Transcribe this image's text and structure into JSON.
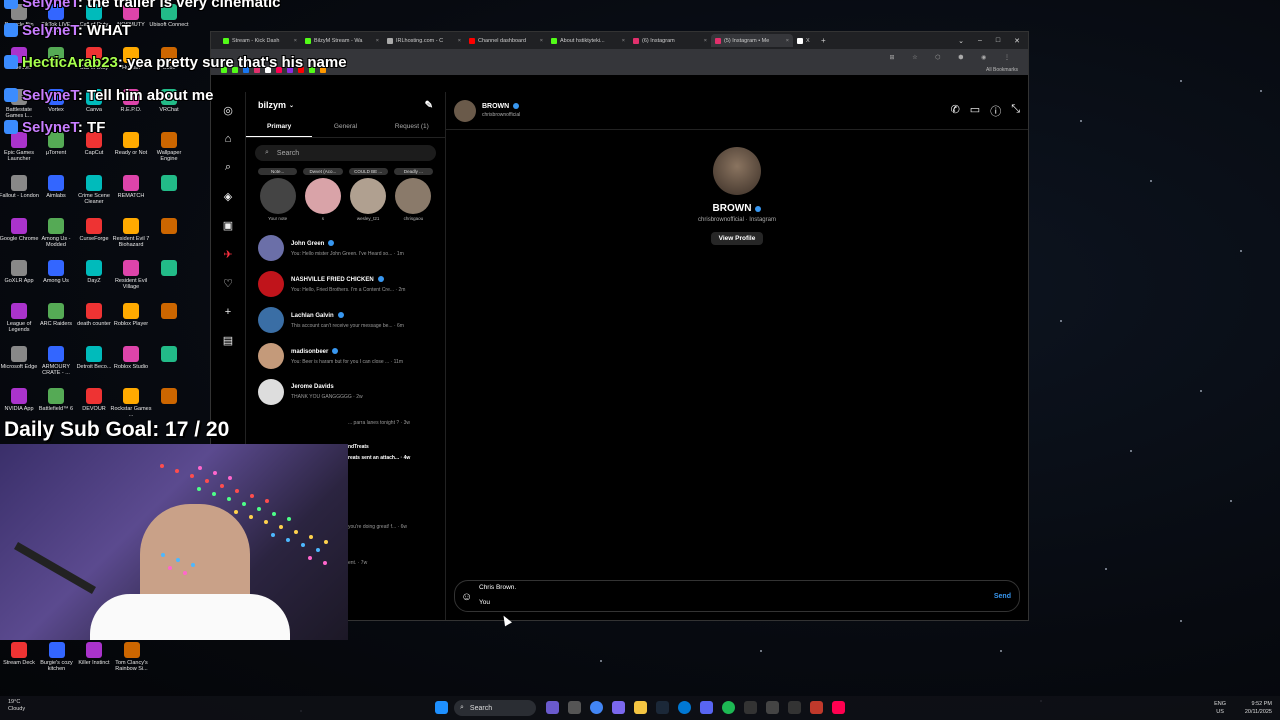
{
  "chat": [
    {
      "user": "SelyneT",
      "msg": ": the trailer is very cinematic"
    },
    {
      "user": "SelyneT",
      "msg": ": WHAT"
    },
    {
      "user": "HecticArab23",
      "msg": ": yea pretty sure that's his name"
    },
    {
      "user": "SelyneT",
      "msg": ": Tell him about me"
    },
    {
      "user": "SelyneT",
      "msg": ": TF"
    }
  ],
  "subgoal": "Daily Sub Goal: 17 / 20",
  "desktop_icons": [
    "Recycle Bin",
    "TikTok LIVE Studio",
    "Call of Duty",
    "NOSMUTY",
    "Ubisoft Connect",
    "Battle.net",
    "",
    "Call of Duty",
    "Human",
    "Code",
    "Battlestate Games L...",
    "Vortex",
    "Canva",
    "R.E.P.O.",
    "VRChat",
    "Epic Games Launcher",
    "µTorrent",
    "CapCut",
    "Ready or Not",
    "Wallpaper Engine",
    "Fallout - London",
    "Aimlabs",
    "Crime Scene Cleaner",
    "REMATCH",
    "",
    "Google Chrome",
    "Among Us - Modded",
    "CurseForge",
    "Resident Evil 7 Biohazard",
    "",
    "GoXLR App",
    "Among Us",
    "DayZ",
    "Resident Evil Village",
    "",
    "League of Legends",
    "ARC Raiders",
    "death counter",
    "Roblox Player",
    "",
    "Microsoft Edge",
    "ARMOURY CRATE - ...",
    "Detroit Beco...",
    "Roblox Studio",
    "",
    "NVIDIA App",
    "Battlefield™ 6",
    "DEVOUR",
    "Rockstar Games ...",
    ""
  ],
  "bottom_icons": [
    "Stream Deck",
    "Burgie's cozy kitchen",
    "Killer Instinct",
    "Tom Clancy's Rainbow Si..."
  ],
  "browser": {
    "tabs": [
      {
        "label": "Stream - Kick Dash",
        "color": "#53fc18"
      },
      {
        "label": "BilzyM Stream - Wa",
        "color": "#53fc18"
      },
      {
        "label": "IRLhosting.com - C",
        "color": "#aaaaaa"
      },
      {
        "label": "Channel dashboard",
        "color": "#ff0000"
      },
      {
        "label": "About hstiktyteki...",
        "color": "#53fc18"
      },
      {
        "label": "(6) Instagram",
        "color": "#e1306c"
      },
      {
        "label": "(5) Instagram • Me",
        "color": "#e1306c"
      },
      {
        "label": "X",
        "color": "#ffffff"
      }
    ],
    "bookmarks_label": "All Bookmarks"
  },
  "instagram": {
    "account": "bilzym",
    "tabs": [
      "Primary",
      "General",
      "Request (1)"
    ],
    "search_placeholder": "Search",
    "notes": [
      {
        "bubble": "Note...",
        "label": "Your note"
      },
      {
        "bubble": "Dwvet (Aco...",
        "label": "s"
      },
      {
        "bubble": "COULD BE ...",
        "label": "wesley_t21"
      },
      {
        "bubble": "Deadly ...",
        "label": "chrisgaou"
      }
    ],
    "conversations": [
      {
        "name": "John Green",
        "verified": true,
        "preview": "You: Hello mister John Green. I've Heard so... · 1m"
      },
      {
        "name": "NASHVILLE FRIED CHICKEN",
        "verified": true,
        "preview": "You: Hello, Fried Brothers. I'm a Content Cre... · 2m"
      },
      {
        "name": "Lachlan Galvin",
        "verified": true,
        "preview": "This account can't receive your message be... · 6m"
      },
      {
        "name": "madisonbeer",
        "verified": true,
        "preview": "You: Beer is haram but for you I can close ... · 11m"
      },
      {
        "name": "Jerome Davids",
        "verified": false,
        "preview": "THANK YOU GANGGGGG · 2w"
      }
    ],
    "partial_previews": [
      "... parra lanes tonight ? · 3w",
      "ndTreats",
      "reats sent an attach... · 4w",
      "you're doing great! f... · 6w",
      "ent. · 7w"
    ],
    "thread": {
      "name": "BROWN",
      "username": "chrisbrownofficial",
      "profile_name": "BROWN",
      "profile_sub": "chrisbrownofficial · Instagram",
      "view_profile": "View Profile",
      "draft_line1": "Chris Brown.",
      "draft_line2": "You",
      "send": "Send"
    }
  },
  "taskbar": {
    "weather_temp": "19°C",
    "weather_desc": "Cloudy",
    "search": "Search",
    "lang1": "ENG",
    "lang2": "US",
    "time": "9:52 PM",
    "date": "20/11/2025"
  }
}
